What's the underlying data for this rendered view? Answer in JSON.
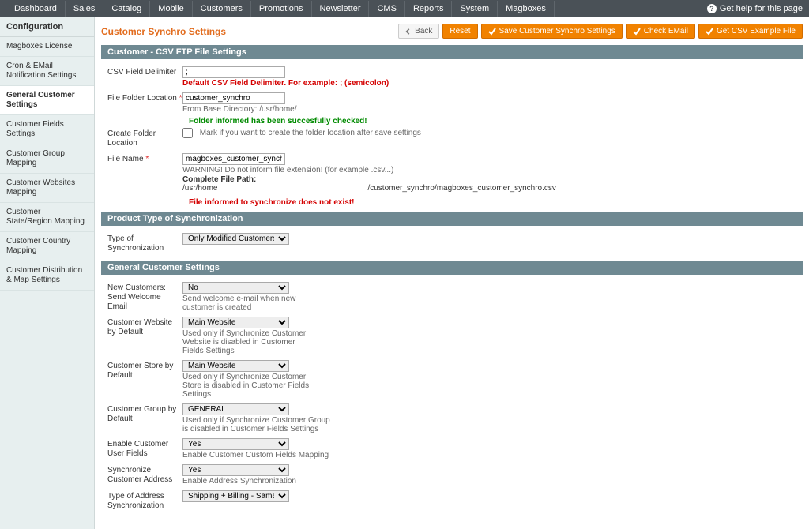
{
  "topnav": {
    "items": [
      "Dashboard",
      "Sales",
      "Catalog",
      "Mobile",
      "Customers",
      "Promotions",
      "Newsletter",
      "CMS",
      "Reports",
      "System",
      "Magboxes"
    ],
    "help": "Get help for this page"
  },
  "sidebar": {
    "heading": "Configuration",
    "items": [
      {
        "label": "Magboxes License"
      },
      {
        "label": "Cron & EMail Notification Settings"
      },
      {
        "label": "General Customer Settings",
        "active": true
      },
      {
        "label": "Customer Fields Settings"
      },
      {
        "label": "Customer Group Mapping"
      },
      {
        "label": "Customer Websites Mapping"
      },
      {
        "label": "Customer State/Region Mapping"
      },
      {
        "label": "Customer Country Mapping"
      },
      {
        "label": "Customer Distribution & Map Settings"
      }
    ]
  },
  "header": {
    "title": "Customer Synchro Settings",
    "back": "Back",
    "reset": "Reset",
    "save": "Save Customer Synchro Settings",
    "check": "Check EMail",
    "csv": "Get CSV Example File"
  },
  "sections": {
    "ftp": {
      "title": "Customer - CSV FTP File Settings",
      "csv_delim_label": "CSV Field Delimiter",
      "csv_delim_value": ";",
      "csv_delim_note": "Default CSV Field Delimiter. For example: ; (semicolon)",
      "folder_label": "File Folder Location",
      "folder_value": "customer_synchro",
      "folder_note": "From Base Directory: /usr/home/",
      "folder_ok": "Folder informed has been succesfully checked!",
      "create_label": "Create Folder Location",
      "create_note": "Mark if you want to create the folder location after save settings",
      "filename_label": "File Name",
      "filename_value": "magboxes_customer_synchro",
      "filename_note": "WARNING! Do not inform file extension! (for example .csv...)",
      "path_label": "Complete File Path:",
      "path_left": "/usr/home",
      "path_right": "/customer_synchro/magboxes_customer_synchro.csv",
      "file_missing": "File informed to synchronize does not exist!"
    },
    "sync": {
      "title": "Product Type of Synchronization",
      "type_label": "Type of Synchronization",
      "type_value": "Only Modified Customers"
    },
    "general": {
      "title": "General Customer Settings",
      "welcome_label": "New Customers: Send Welcome Email",
      "welcome_value": "No",
      "welcome_note": "Send welcome e-mail when new customer is created",
      "website_label": "Customer Website by Default",
      "website_value": "Main Website",
      "website_note": "Used only if Synchronize Customer Website is disabled in Customer Fields Settings",
      "store_label": "Customer Store by Default",
      "store_value": "Main Website",
      "store_note": "Used only if Synchronize Customer Store is disabled in Customer Fields Settings",
      "group_label": "Customer Group by Default",
      "group_value": "GENERAL",
      "group_note": "Used only if Synchronize Customer Group is disabled in Customer Fields Settings",
      "userfields_label": "Enable Customer User Fields",
      "userfields_value": "Yes",
      "userfields_note": "Enable Customer Custom Fields Mapping",
      "address_label": "Synchronize Customer Address",
      "address_value": "Yes",
      "address_note": "Enable Address Synchronization",
      "addrtype_label": "Type of Address Synchronization",
      "addrtype_value": "Shipping + Billing - Same address"
    }
  }
}
